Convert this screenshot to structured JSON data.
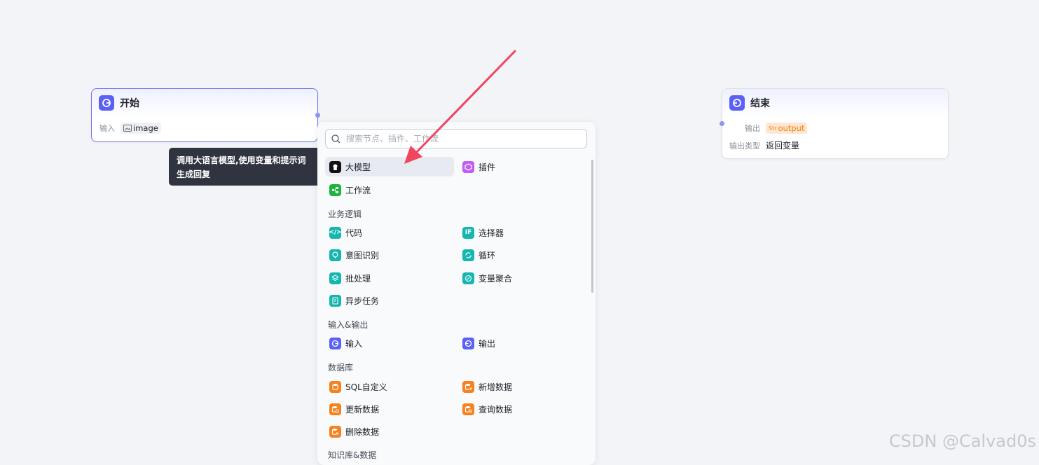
{
  "start_node": {
    "title": "开始",
    "input_label": "输入",
    "input_value": "image"
  },
  "end_node": {
    "title": "结束",
    "output_label": "输出",
    "output_value": "output",
    "output_type_label": "输出类型",
    "output_type_value": "返回变量"
  },
  "tooltip": {
    "text": "调用大语言模型,使用变量和提示词生成回复"
  },
  "panel": {
    "search_placeholder": "搜索节点、插件、工作流",
    "top_items": [
      "大模型",
      "插件",
      "工作流"
    ],
    "sections": [
      {
        "title": "业务逻辑",
        "items": [
          "代码",
          "选择器",
          "意图识别",
          "循环",
          "批处理",
          "变量聚合",
          "异步任务"
        ]
      },
      {
        "title": "输入&输出",
        "items": [
          "输入",
          "输出"
        ]
      },
      {
        "title": "数据库",
        "items": [
          "SQL自定义",
          "新增数据",
          "更新数据",
          "查询数据",
          "删除数据"
        ]
      },
      {
        "title": "知识库&数据"
      }
    ]
  },
  "watermark": "CSDN @Calvad0s",
  "colors": {
    "accent": "#5b61f4",
    "teal": "#16b6b0",
    "orange": "#f5821f",
    "arrow": "#f2445c"
  }
}
